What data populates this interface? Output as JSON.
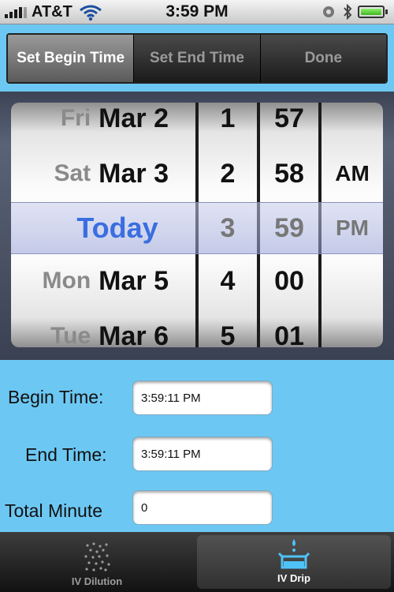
{
  "status_bar": {
    "carrier": "AT&T",
    "time": "3:59 PM"
  },
  "segments": [
    {
      "label": "Set Begin Time",
      "selected": true
    },
    {
      "label": "Set End Time",
      "selected": false
    },
    {
      "label": "Done",
      "selected": false
    }
  ],
  "picker": {
    "dates": [
      {
        "day": "Fri",
        "date": "Mar 2"
      },
      {
        "day": "Sat",
        "date": "Mar 3"
      },
      {
        "day": "",
        "date": "Today"
      },
      {
        "day": "Mon",
        "date": "Mar 5"
      },
      {
        "day": "Tue",
        "date": "Mar 6"
      }
    ],
    "hours": [
      "1",
      "2",
      "3",
      "4",
      "5"
    ],
    "minutes": [
      "57",
      "58",
      "59",
      "00",
      "01"
    ],
    "ampm": [
      "AM",
      "PM"
    ]
  },
  "form": {
    "begin_label": "Begin Time:",
    "begin_value": "3:59:11 PM",
    "end_label": "End Time:",
    "end_value": "3:59:11 PM",
    "total_label": "Total Minute",
    "total_value": "0"
  },
  "tabs": [
    {
      "label": "IV Dilution",
      "active": false,
      "icon": "dots-icon"
    },
    {
      "label": "IV Drip",
      "active": true,
      "icon": "drip-icon"
    }
  ]
}
